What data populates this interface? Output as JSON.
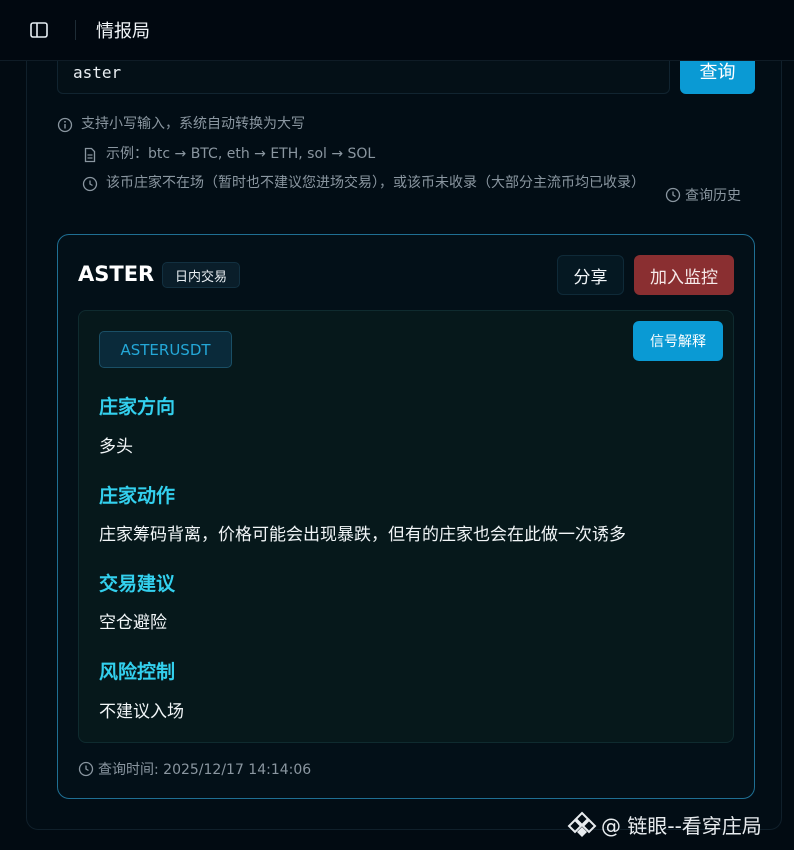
{
  "header": {
    "title": "情报局",
    "toggle_icon": "sidebar-toggle-icon"
  },
  "search": {
    "value": "aster",
    "button_label": "查询"
  },
  "hints": [
    {
      "icon": "info-icon",
      "text": "支持小写输入，系统自动转换为大写"
    },
    {
      "icon": "document-icon",
      "text": "示例：btc → BTC, eth → ETH, sol → SOL"
    },
    {
      "icon": "clock-icon",
      "text": "该币庄家不在场（暂时也不建议您进场交易），或该币未收录（大部分主流币均已收录）"
    }
  ],
  "history": {
    "label": "查询历史",
    "icon": "clock-icon"
  },
  "result": {
    "symbol": "ASTER",
    "mode": "日内交易",
    "share_label": "分享",
    "watch_label": "加入监控",
    "pair": "ASTERUSDT",
    "explain_label": "信号解释",
    "sections": [
      {
        "label": "庄家方向",
        "value": "多头"
      },
      {
        "label": "庄家动作",
        "value": "庄家筹码背离，价格可能会出现暴跌，但有的庄家也会在此做一次诱多"
      },
      {
        "label": "交易建议",
        "value": "空仓避险"
      },
      {
        "label": "风险控制",
        "value": "不建议入场"
      }
    ],
    "query_time": "查询时间: 2025/12/17 14:14:06"
  },
  "watermark": {
    "text": "@ 链眼--看穿庄局"
  },
  "colors": {
    "accent": "#0a9ad4",
    "danger": "#8a2f31",
    "section_label": "#33d0ee"
  }
}
